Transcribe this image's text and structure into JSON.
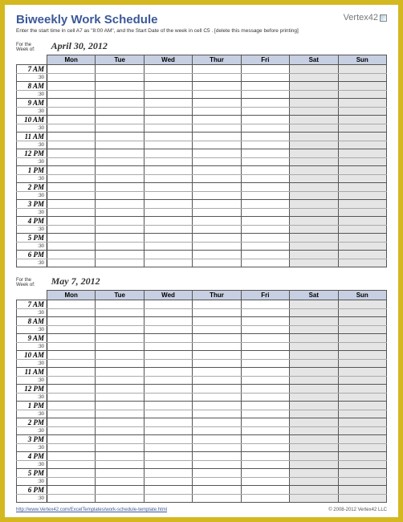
{
  "title": "Biweekly Work Schedule",
  "instructions": "Enter the start time in cell A7 as \"8:00 AM\", and the Start Date of the week in cell C5 . [delete this message before printing]",
  "logo_text": "Vertex42",
  "week_label_line1": "For the",
  "week_label_line2": "Week of:",
  "weeks": [
    {
      "date": "April 30, 2012"
    },
    {
      "date": "May 7, 2012"
    }
  ],
  "days": [
    "Mon",
    "Tue",
    "Wed",
    "Thur",
    "Fri",
    "Sat",
    "Sun"
  ],
  "hours": [
    "7 AM",
    "8 AM",
    "9 AM",
    "10 AM",
    "11 AM",
    "12 PM",
    "1 PM",
    "2 PM",
    "3 PM",
    "4 PM",
    "5 PM",
    "6 PM"
  ],
  "half_label": ":30",
  "footer_link": "http://www.Vertex42.com/ExcelTemplates/work-schedule-template.html",
  "footer_copyright": "© 2008-2012 Vertex42 LLC"
}
